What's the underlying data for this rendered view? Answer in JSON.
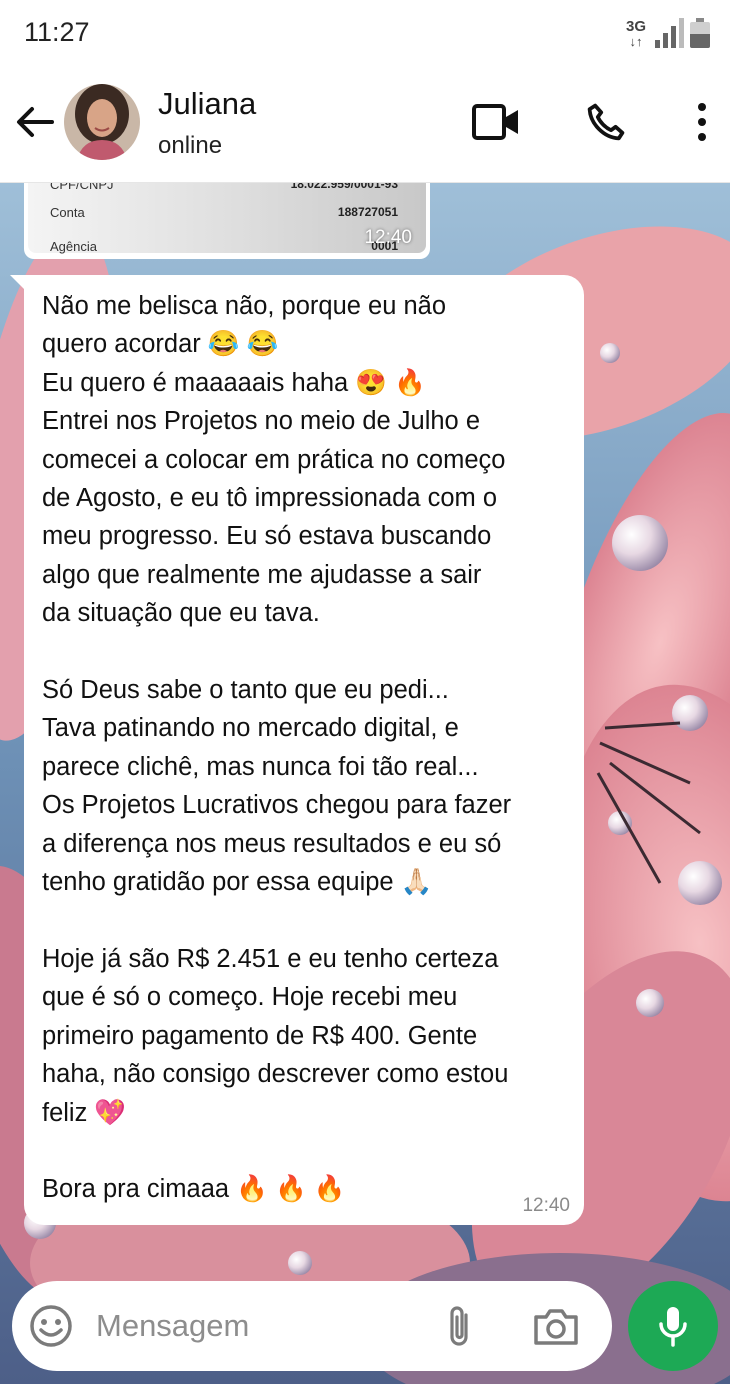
{
  "status_bar": {
    "time": "11:27",
    "network": "3G",
    "network_arrows": "↓↑"
  },
  "header": {
    "contact_name": "Juliana",
    "contact_status": "online"
  },
  "previous_message": {
    "rows": [
      {
        "label": "CPF/CNPJ",
        "value": "18.022.959/0001-93"
      },
      {
        "label": "Conta",
        "value": "188727051"
      },
      {
        "label": "Agência",
        "value": "0001"
      }
    ],
    "time": "12:40"
  },
  "message": {
    "text": "Não me belisca não, porque eu não\nquero acordar 😂 😂\nEu quero é maaaaais haha 😍 🔥\nEntrei nos Projetos no meio de Julho e\ncomecei a colocar em prática no começo\nde Agosto, e eu tô impressionada com o\nmeu progresso. Eu só estava buscando\nalgo que realmente me ajudasse a sair\nda situação que eu tava.\n\nSó Deus sabe o tanto que eu pedi...\nTava patinando no mercado digital, e\nparece clichê, mas nunca foi tão real...\nOs Projetos Lucrativos chegou para fazer\na diferença nos meus resultados e eu só\ntenho gratidão por essa equipe 🙏🏻\n\nHoje já são R$ 2.451 e eu tenho certeza\nque é só o começo. Hoje recebi meu\nprimeiro pagamento de R$ 400. Gente\nhaha, não consigo descrever como estou\nfeliz 💖\n\nBora pra cimaaa 🔥 🔥 🔥",
    "time": "12:40"
  },
  "composer": {
    "placeholder": "Mensagem"
  },
  "colors": {
    "accent": "#1da955",
    "bubble": "#ffffff",
    "header": "#ffffff"
  }
}
